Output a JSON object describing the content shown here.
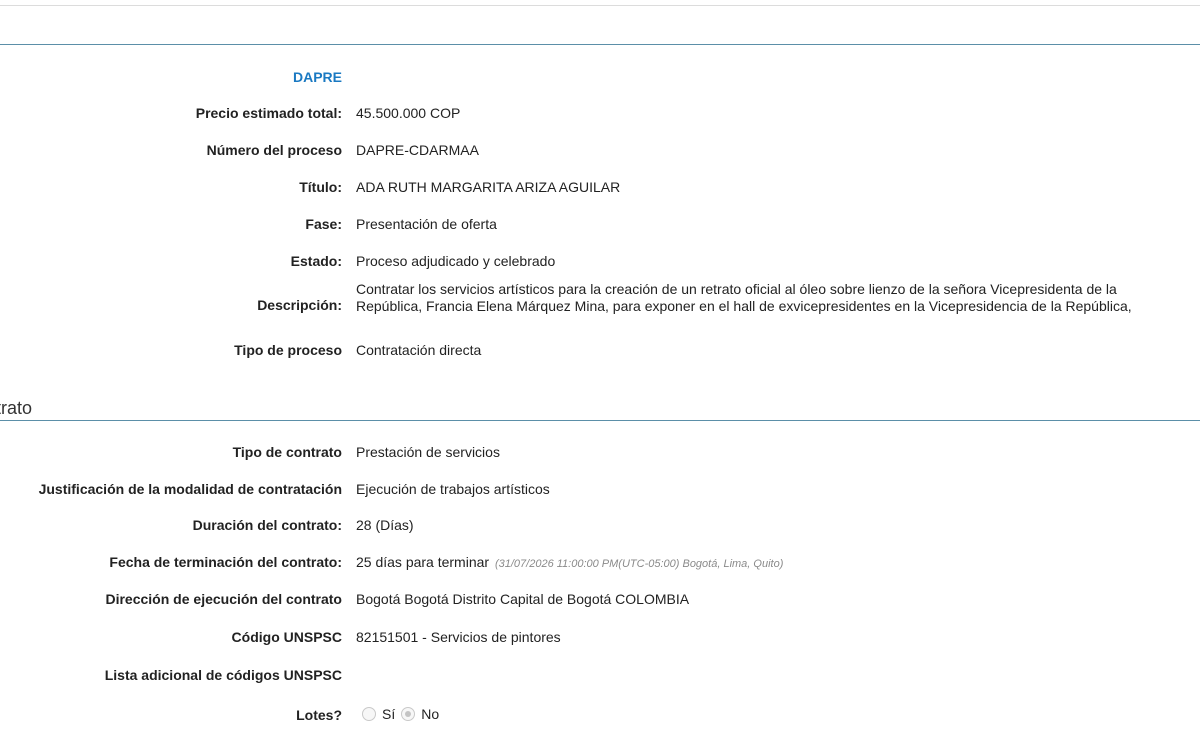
{
  "header": {
    "entity": "DAPRE"
  },
  "process_info": {
    "rows": [
      {
        "label": "Precio estimado total:",
        "value": "45.500.000 COP"
      },
      {
        "label": "Número del proceso",
        "value": "DAPRE-CDARMAA"
      },
      {
        "label": "Título:",
        "value": "ADA RUTH MARGARITA ARIZA AGUILAR"
      },
      {
        "label": "Fase:",
        "value": "Presentación de oferta"
      },
      {
        "label": "Estado:",
        "value": "Proceso adjudicado y celebrado"
      },
      {
        "label": "Descripción:",
        "value": "Contratar los servicios artísticos para la creación de un retrato oficial al óleo sobre lienzo de la señora Vicepresidenta de la República, Francia Elena Márquez Mina, para exponer en el hall de exvicepresidentes en la Vicepresidencia de la República,"
      },
      {
        "label": "Tipo de proceso",
        "value": "Contratación directa"
      }
    ]
  },
  "contract_section": {
    "title": "ntrato",
    "rows": [
      {
        "label": "Tipo de contrato",
        "value": "Prestación de servicios"
      },
      {
        "label": "Justificación de la modalidad de contratación",
        "value": "Ejecución de trabajos artísticos"
      },
      {
        "label": "Duración del contrato:",
        "value": "28 (Días)"
      },
      {
        "label": "Fecha de terminación del contrato:",
        "value": "25 días para terminar",
        "note": "(31/07/2026 11:00:00 PM(UTC-05:00) Bogotá, Lima, Quito)"
      },
      {
        "label": "Dirección de ejecución del contrato",
        "value": "Bogotá Bogotá Distrito Capital de Bogotá COLOMBIA"
      },
      {
        "label": "Código UNSPSC",
        "value": "82151501 - Servicios de pintores"
      },
      {
        "label": "Lista adicional de códigos UNSPSC",
        "value": ""
      },
      {
        "label": "Lotes?",
        "value": ""
      }
    ],
    "lotes_options": {
      "yes_label": "Sí",
      "no_label": "No",
      "selected": "No"
    }
  }
}
